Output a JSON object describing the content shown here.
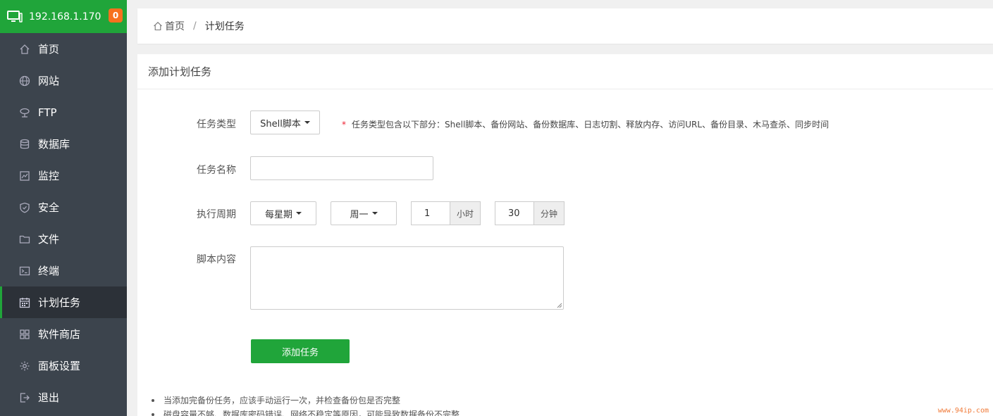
{
  "sidebar": {
    "ip": "192.168.1.170",
    "badge": "0",
    "items": [
      {
        "label": "首页",
        "icon": "home-icon"
      },
      {
        "label": "网站",
        "icon": "globe-icon"
      },
      {
        "label": "FTP",
        "icon": "ftp-icon"
      },
      {
        "label": "数据库",
        "icon": "database-icon"
      },
      {
        "label": "监控",
        "icon": "monitor-chart-icon"
      },
      {
        "label": "安全",
        "icon": "shield-icon"
      },
      {
        "label": "文件",
        "icon": "folder-icon"
      },
      {
        "label": "终端",
        "icon": "terminal-icon"
      },
      {
        "label": "计划任务",
        "icon": "calendar-icon",
        "active": true
      },
      {
        "label": "软件商店",
        "icon": "grid-icon"
      },
      {
        "label": "面板设置",
        "icon": "gear-icon"
      },
      {
        "label": "退出",
        "icon": "logout-icon"
      }
    ]
  },
  "breadcrumb": {
    "home": "首页",
    "separator": "/",
    "current": "计划任务"
  },
  "panel": {
    "title": "添加计划任务"
  },
  "form": {
    "task_type": {
      "label": "任务类型",
      "value": "Shell脚本",
      "hint_star": "*",
      "hint": "任务类型包含以下部分：Shell脚本、备份网站、备份数据库、日志切割、释放内存、访问URL、备份目录、木马查杀、同步时间"
    },
    "task_name": {
      "label": "任务名称",
      "value": ""
    },
    "schedule": {
      "label": "执行周期",
      "period": "每星期",
      "weekday": "周一",
      "hour": "1",
      "hour_unit": "小时",
      "minute": "30",
      "minute_unit": "分钟"
    },
    "script": {
      "label": "脚本内容",
      "value": ""
    },
    "submit_label": "添加任务"
  },
  "notes": [
    "当添加完备份任务，应该手动运行一次，并检查备份包是否完整",
    "磁盘容量不够、数据库密码错误、网络不稳定等原因，可能导致数据备份不完整"
  ],
  "watermark": "www.94ip.com",
  "colors": {
    "brand_green": "#20a53a",
    "sidebar_bg": "#3c444d",
    "badge_orange": "#f7711e"
  }
}
